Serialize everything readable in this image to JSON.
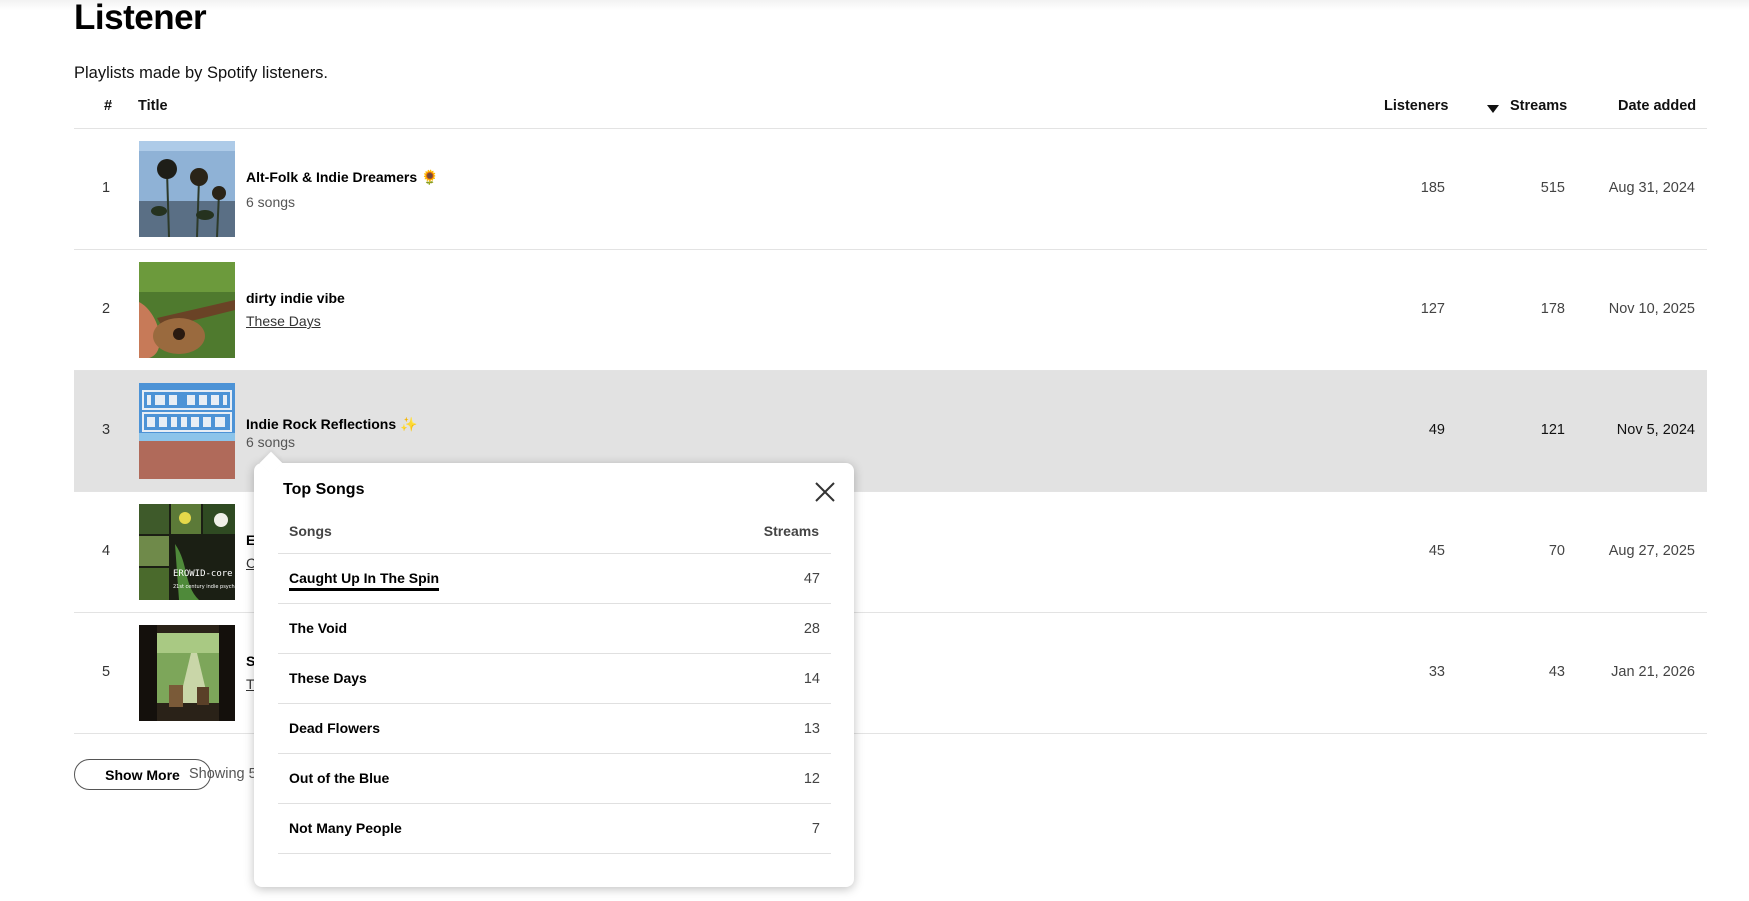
{
  "page": {
    "heading": "Listener",
    "subtitle": "Playlists made by Spotify listeners."
  },
  "table": {
    "headers": {
      "rank": "#",
      "title": "Title",
      "listeners": "Listeners",
      "streams": "Streams",
      "date_added": "Date added"
    },
    "sort": {
      "column": "Streams",
      "direction": "descending"
    },
    "rows": [
      {
        "rank": "1",
        "name": "Alt-Folk & Indie Dreamers 🌻",
        "sub": "6 songs",
        "sub_is_link": false,
        "listeners": "185",
        "streams": "515",
        "date": "Aug 31, 2024"
      },
      {
        "rank": "2",
        "name": "dirty indie vibe",
        "sub": "These Days",
        "sub_is_link": true,
        "listeners": "127",
        "streams": "178",
        "date": "Nov 10, 2025"
      },
      {
        "rank": "3",
        "name": "Indie Rock Reflections ✨",
        "sub": "6 songs",
        "sub_is_link": false,
        "listeners": "49",
        "streams": "121",
        "date": "Nov 5, 2024",
        "highlighted": true
      },
      {
        "rank": "4",
        "name": "E",
        "sub": "C",
        "sub_is_link": true,
        "listeners": "45",
        "streams": "70",
        "date": "Aug 27, 2025"
      },
      {
        "rank": "5",
        "name": "S",
        "sub": "T",
        "sub_is_link": true,
        "listeners": "33",
        "streams": "43",
        "date": "Jan 21, 2026"
      }
    ]
  },
  "footer": {
    "show_more_label": "Show More",
    "showing_text": "Showing 5"
  },
  "popup": {
    "title": "Top Songs",
    "col_songs": "Songs",
    "col_streams": "Streams",
    "songs": [
      {
        "name": "Caught Up In The Spin",
        "streams": "47"
      },
      {
        "name": "The Void",
        "streams": "28"
      },
      {
        "name": "These Days",
        "streams": "14"
      },
      {
        "name": "Dead Flowers",
        "streams": "13"
      },
      {
        "name": "Out of the Blue",
        "streams": "12"
      },
      {
        "name": "Not Many People",
        "streams": "7"
      }
    ]
  },
  "icons": {
    "sort": "caret-down-icon",
    "close": "close-icon"
  }
}
